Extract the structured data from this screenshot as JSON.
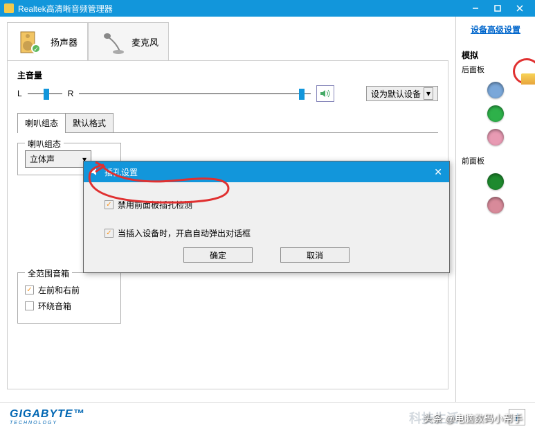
{
  "titlebar": {
    "title": "Realtek高清晰音频管理器"
  },
  "tabs": {
    "speaker": "扬声器",
    "mic": "麦克风"
  },
  "mainVolume": {
    "label": "主音量",
    "leftLetter": "L",
    "rightLetter": "R",
    "balancePos": 50,
    "mainPos": 96
  },
  "defaultBtn": "设为默认设备",
  "subtabs": {
    "config": "喇叭组态",
    "format": "默认格式"
  },
  "speakerConfig": {
    "groupTitle": "喇叭组态",
    "selected": "立体声"
  },
  "fullRange": {
    "groupTitle": "全范围音箱",
    "opt1": "左前和右前",
    "opt1Checked": true,
    "opt2": "环绕音箱",
    "opt2Checked": false
  },
  "sidePanel": {
    "advLink": "设备高级设置",
    "analogLabel": "模拟",
    "backPanel": "后面板",
    "frontPanel": "前面板",
    "jacks": {
      "back": [
        "#7aa7d9",
        "#2eb14a",
        "#e89ab3"
      ],
      "front": [
        "#1e8a2e",
        "#d88a9a"
      ]
    }
  },
  "dialog": {
    "title": "插孔设置",
    "opt1": "禁用前面板插孔检测",
    "opt1Checked": true,
    "opt2": "当插入设备时，开启自动弹出对话框",
    "opt2Checked": true,
    "ok": "确定",
    "cancel": "取消"
  },
  "footer": {
    "brand": "GIGABYTE",
    "brandSub": "TECHNOLOGY",
    "info": "i"
  },
  "watermark": "头条 @电脑数码小帮手"
}
